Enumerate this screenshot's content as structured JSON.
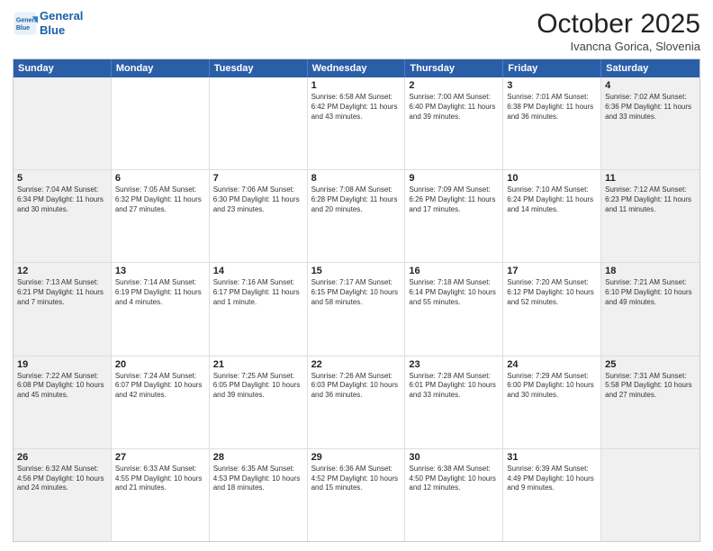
{
  "header": {
    "logo_line1": "General",
    "logo_line2": "Blue",
    "title": "October 2025",
    "subtitle": "Ivancna Gorica, Slovenia"
  },
  "days_of_week": [
    "Sunday",
    "Monday",
    "Tuesday",
    "Wednesday",
    "Thursday",
    "Friday",
    "Saturday"
  ],
  "weeks": [
    [
      {
        "day": "",
        "info": ""
      },
      {
        "day": "",
        "info": ""
      },
      {
        "day": "",
        "info": ""
      },
      {
        "day": "1",
        "info": "Sunrise: 6:58 AM\nSunset: 6:42 PM\nDaylight: 11 hours\nand 43 minutes."
      },
      {
        "day": "2",
        "info": "Sunrise: 7:00 AM\nSunset: 6:40 PM\nDaylight: 11 hours\nand 39 minutes."
      },
      {
        "day": "3",
        "info": "Sunrise: 7:01 AM\nSunset: 6:38 PM\nDaylight: 11 hours\nand 36 minutes."
      },
      {
        "day": "4",
        "info": "Sunrise: 7:02 AM\nSunset: 6:36 PM\nDaylight: 11 hours\nand 33 minutes."
      }
    ],
    [
      {
        "day": "5",
        "info": "Sunrise: 7:04 AM\nSunset: 6:34 PM\nDaylight: 11 hours\nand 30 minutes."
      },
      {
        "day": "6",
        "info": "Sunrise: 7:05 AM\nSunset: 6:32 PM\nDaylight: 11 hours\nand 27 minutes."
      },
      {
        "day": "7",
        "info": "Sunrise: 7:06 AM\nSunset: 6:30 PM\nDaylight: 11 hours\nand 23 minutes."
      },
      {
        "day": "8",
        "info": "Sunrise: 7:08 AM\nSunset: 6:28 PM\nDaylight: 11 hours\nand 20 minutes."
      },
      {
        "day": "9",
        "info": "Sunrise: 7:09 AM\nSunset: 6:26 PM\nDaylight: 11 hours\nand 17 minutes."
      },
      {
        "day": "10",
        "info": "Sunrise: 7:10 AM\nSunset: 6:24 PM\nDaylight: 11 hours\nand 14 minutes."
      },
      {
        "day": "11",
        "info": "Sunrise: 7:12 AM\nSunset: 6:23 PM\nDaylight: 11 hours\nand 11 minutes."
      }
    ],
    [
      {
        "day": "12",
        "info": "Sunrise: 7:13 AM\nSunset: 6:21 PM\nDaylight: 11 hours\nand 7 minutes."
      },
      {
        "day": "13",
        "info": "Sunrise: 7:14 AM\nSunset: 6:19 PM\nDaylight: 11 hours\nand 4 minutes."
      },
      {
        "day": "14",
        "info": "Sunrise: 7:16 AM\nSunset: 6:17 PM\nDaylight: 11 hours\nand 1 minute."
      },
      {
        "day": "15",
        "info": "Sunrise: 7:17 AM\nSunset: 6:15 PM\nDaylight: 10 hours\nand 58 minutes."
      },
      {
        "day": "16",
        "info": "Sunrise: 7:18 AM\nSunset: 6:14 PM\nDaylight: 10 hours\nand 55 minutes."
      },
      {
        "day": "17",
        "info": "Sunrise: 7:20 AM\nSunset: 6:12 PM\nDaylight: 10 hours\nand 52 minutes."
      },
      {
        "day": "18",
        "info": "Sunrise: 7:21 AM\nSunset: 6:10 PM\nDaylight: 10 hours\nand 49 minutes."
      }
    ],
    [
      {
        "day": "19",
        "info": "Sunrise: 7:22 AM\nSunset: 6:08 PM\nDaylight: 10 hours\nand 45 minutes."
      },
      {
        "day": "20",
        "info": "Sunrise: 7:24 AM\nSunset: 6:07 PM\nDaylight: 10 hours\nand 42 minutes."
      },
      {
        "day": "21",
        "info": "Sunrise: 7:25 AM\nSunset: 6:05 PM\nDaylight: 10 hours\nand 39 minutes."
      },
      {
        "day": "22",
        "info": "Sunrise: 7:26 AM\nSunset: 6:03 PM\nDaylight: 10 hours\nand 36 minutes."
      },
      {
        "day": "23",
        "info": "Sunrise: 7:28 AM\nSunset: 6:01 PM\nDaylight: 10 hours\nand 33 minutes."
      },
      {
        "day": "24",
        "info": "Sunrise: 7:29 AM\nSunset: 6:00 PM\nDaylight: 10 hours\nand 30 minutes."
      },
      {
        "day": "25",
        "info": "Sunrise: 7:31 AM\nSunset: 5:58 PM\nDaylight: 10 hours\nand 27 minutes."
      }
    ],
    [
      {
        "day": "26",
        "info": "Sunrise: 6:32 AM\nSunset: 4:56 PM\nDaylight: 10 hours\nand 24 minutes."
      },
      {
        "day": "27",
        "info": "Sunrise: 6:33 AM\nSunset: 4:55 PM\nDaylight: 10 hours\nand 21 minutes."
      },
      {
        "day": "28",
        "info": "Sunrise: 6:35 AM\nSunset: 4:53 PM\nDaylight: 10 hours\nand 18 minutes."
      },
      {
        "day": "29",
        "info": "Sunrise: 6:36 AM\nSunset: 4:52 PM\nDaylight: 10 hours\nand 15 minutes."
      },
      {
        "day": "30",
        "info": "Sunrise: 6:38 AM\nSunset: 4:50 PM\nDaylight: 10 hours\nand 12 minutes."
      },
      {
        "day": "31",
        "info": "Sunrise: 6:39 AM\nSunset: 4:49 PM\nDaylight: 10 hours\nand 9 minutes."
      },
      {
        "day": "",
        "info": ""
      }
    ]
  ]
}
